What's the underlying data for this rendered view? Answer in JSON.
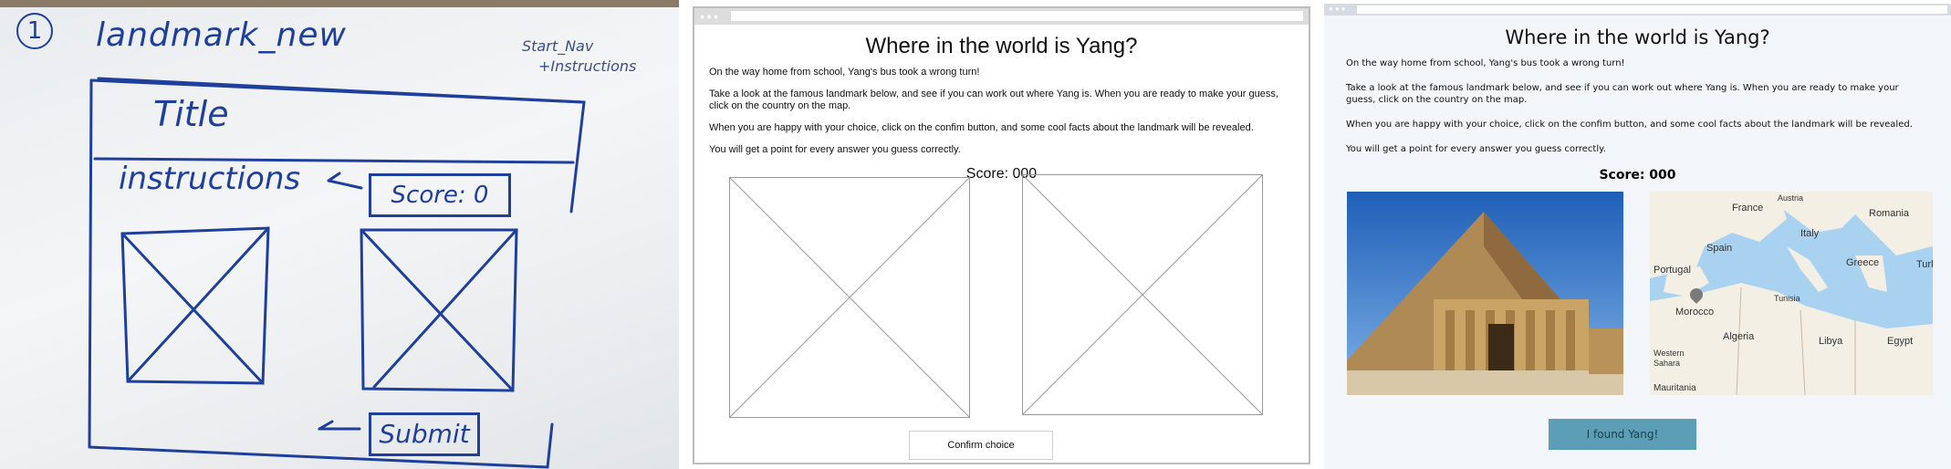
{
  "sketch": {
    "number": "1",
    "heading": "landmark_new",
    "note_line1": "Start_Nav",
    "note_line2": "+Instructions",
    "title": "Title",
    "instructions": "instructions",
    "score": "Score: 0",
    "submit": "Submit"
  },
  "wireframe": {
    "title": "Where in the world is Yang?",
    "p1": "On the way home from school, Yang's bus took a wrong turn!",
    "p2": "Take a look at the famous landmark below, and see if you can work out where Yang is. When you are ready to make your guess, click on the country on the map.",
    "p3": "When you are happy with your choice, click on the confim button, and some cool facts about the landmark will be revealed.",
    "p4": "You will get a point for every answer you guess correctly.",
    "score": "Score: 000",
    "button": "Confirm choice"
  },
  "final": {
    "title": "Where in the world is Yang?",
    "p1": "On the way home from school, Yang's bus took a wrong turn!",
    "p2": "Take a look at the famous landmark below, and see if you can work out where Yang is. When you are ready to make your guess, click on the country on the map.",
    "p3": "When you are happy with your choice, click on the confim button, and some cool facts about the landmark will be revealed.",
    "p4": "You will get a point for every answer you guess correctly.",
    "score": "Score: 000",
    "button": "I found Yang!",
    "map_labels": {
      "austria": "Austria",
      "france": "France",
      "romania": "Romania",
      "italy": "Italy",
      "spain": "Spain",
      "greece": "Greece",
      "turkey": "Turk",
      "portugal": "Portugal",
      "tunisia": "Tunisia",
      "morocco": "Morocco",
      "algeria": "Algeria",
      "libya": "Libya",
      "egypt": "Egypt",
      "western": "Western",
      "sahara": "Sahara",
      "mauritania": "Mauritania"
    }
  },
  "colors": {
    "ink": "#1f3f9c",
    "button": "#5b9eb6",
    "sea": "#a8d2f0",
    "land": "#f3efe4"
  }
}
